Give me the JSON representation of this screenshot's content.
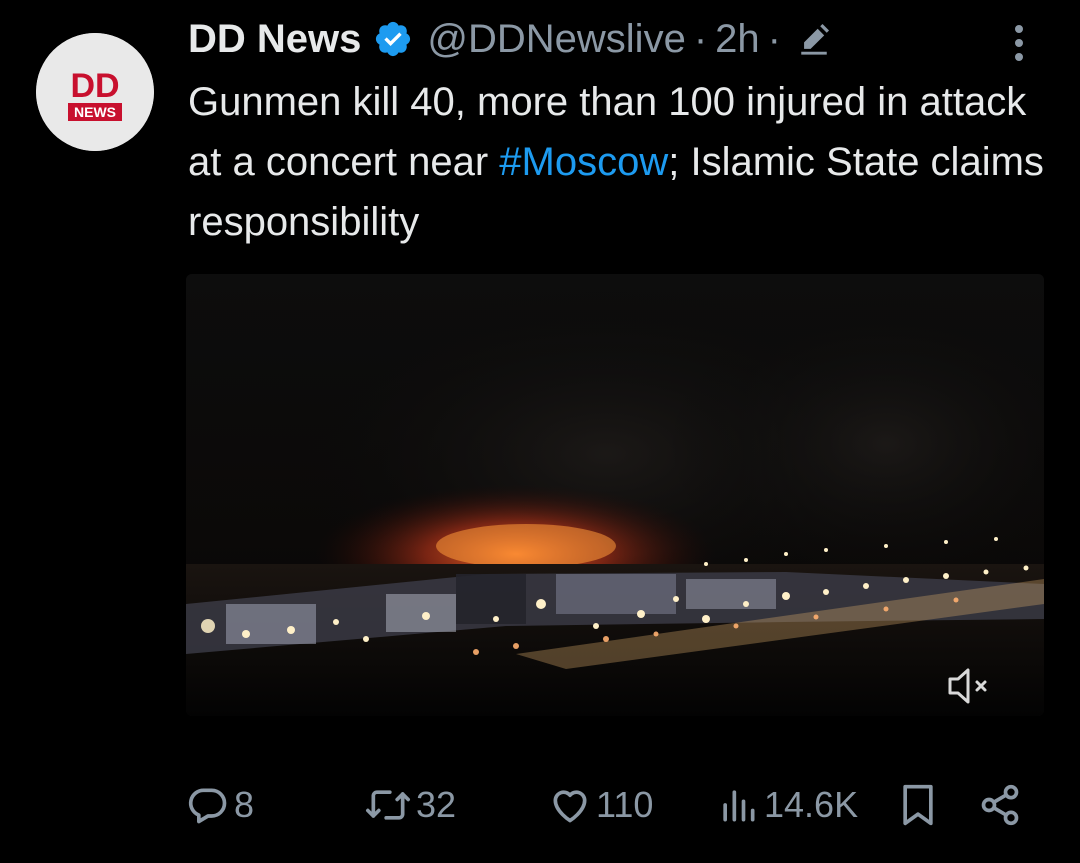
{
  "tweet": {
    "display_name": "DD News",
    "handle": "@DDNewslive",
    "separator": "·",
    "time": "2h",
    "avatar": {
      "logo_top": "DD",
      "logo_bottom": "NEWS"
    },
    "text": {
      "before": "Gunmen kill 40, more than 100 injured in attack at a concert near ",
      "hashtag": "#Moscow",
      "after": "; Islamic State claims responsibility"
    },
    "media": {
      "type": "video",
      "icon": "mute-icon"
    },
    "actions": {
      "replies": "8",
      "reposts": "32",
      "likes": "110",
      "views": "14.6K"
    },
    "icons": {
      "verified": "verified-badge-icon",
      "edit": "edit-pencil-icon",
      "more": "more-vertical-icon",
      "reply": "reply-bubble-icon",
      "repost": "repost-icon",
      "like": "heart-icon",
      "views": "views-bars-icon",
      "bookmark": "bookmark-icon",
      "share": "share-icon"
    }
  },
  "colors": {
    "background": "#000000",
    "text": "#e7e9ea",
    "secondary": "#8b98a5",
    "accent": "#1d9bf0",
    "logo_red": "#c8102e"
  }
}
